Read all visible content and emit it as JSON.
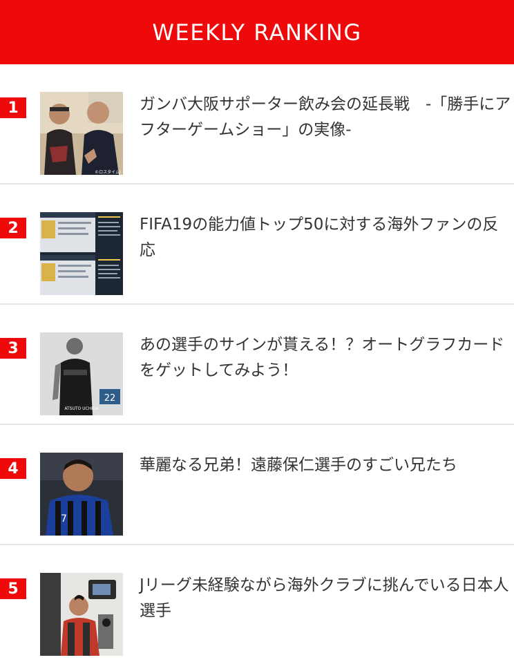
{
  "header": {
    "title": "WEEKLY RANKING"
  },
  "ranking": [
    {
      "rank": "1",
      "title": "ガンバ大阪サポーター飲み会の延長戦　-「勝手にアフターゲームショー」の実像-",
      "thumb_caption": "©ロスタイムJ"
    },
    {
      "rank": "2",
      "title": "FIFA19の能力値トップ50に対する海外ファンの反応"
    },
    {
      "rank": "3",
      "title": "あの選手のサインが貰える！？オートグラフカードをゲットしてみよう！",
      "thumb_caption": "ATSUTO UCHIDA",
      "thumb_number": "22"
    },
    {
      "rank": "4",
      "title": "華麗なる兄弟！遠藤保仁選手のすごい兄たち",
      "thumb_number": "7"
    },
    {
      "rank": "5",
      "title": "Jリーグ未経験ながら海外クラブに挑んでいる日本人選手"
    }
  ],
  "colors": {
    "accent": "#ee0a0a",
    "text": "#333333",
    "divider": "#e6e6e6"
  }
}
